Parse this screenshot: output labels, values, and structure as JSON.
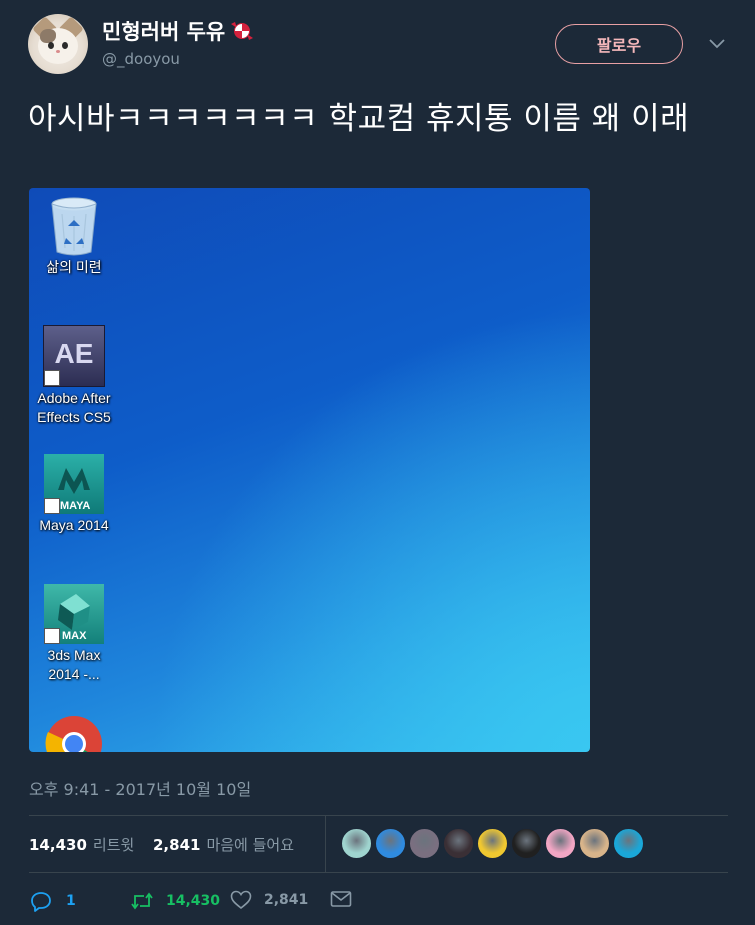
{
  "user": {
    "display_name": "민형러버 두유",
    "handle": "@_dooyou"
  },
  "follow_button_label": "팔로우",
  "tweet": {
    "text": "아시바ㅋㅋㅋㅋㅋㅋㅋ 학교컴 휴지통 이름 왜 이래",
    "timestamp": "오후 9:41 - 2017년 10월 10일"
  },
  "desktop_icons": [
    {
      "label_line1": "삶의 미련",
      "label_line2": "",
      "icon": "recycle-bin-icon"
    },
    {
      "label_line1": "Adobe After",
      "label_line2": "Effects CS5",
      "icon": "after-effects-icon",
      "tile_text": "AE"
    },
    {
      "label_line1": "Maya 2014",
      "label_line2": "",
      "icon": "maya-icon",
      "tile_text": "MAYA"
    },
    {
      "label_line1": "3ds Max",
      "label_line2": "2014 -...",
      "icon": "3ds-max-icon",
      "tile_text": "MAX"
    },
    {
      "label_line1": "",
      "label_line2": "",
      "icon": "chrome-icon"
    }
  ],
  "stats": {
    "retweets_count": "14,430",
    "retweets_label": "리트윗",
    "likes_count": "2,841",
    "likes_label": "마음에 들어요"
  },
  "liker_avatars": [
    {
      "color": "#9fd4cf"
    },
    {
      "color": "#2f8be0"
    },
    {
      "color": "#7a6f80"
    },
    {
      "color": "#3a2f35"
    },
    {
      "color": "#f0c830"
    },
    {
      "color": "#202020"
    },
    {
      "color": "#f2a6c4"
    },
    {
      "color": "#d8b48a"
    },
    {
      "color": "#1aa7d8"
    }
  ],
  "actions": {
    "reply_count": "1",
    "retweet_count": "14,430",
    "like_count": "2,841"
  },
  "colors": {
    "background": "#1c2938",
    "muted_text": "#8899a6",
    "accent_blue": "#1da1f2",
    "retweet_green": "#17bf63",
    "follow_pink": "#e8a0a4"
  }
}
